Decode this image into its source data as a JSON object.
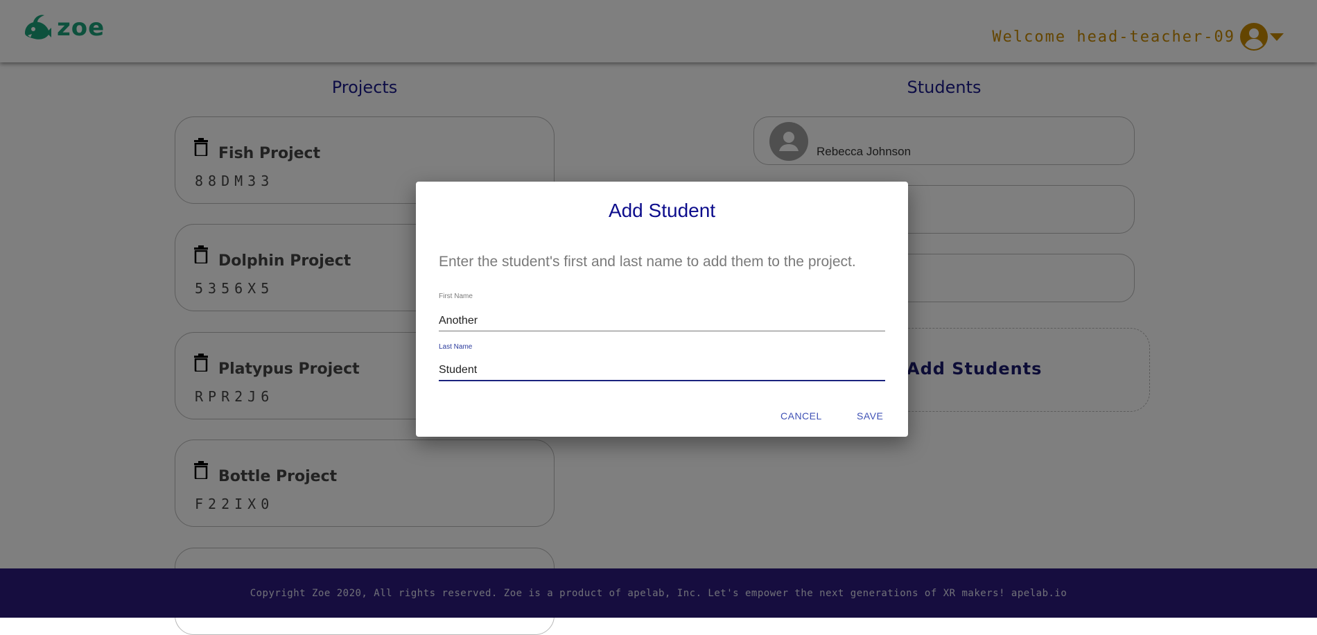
{
  "header": {
    "logo_text": "zoe",
    "welcome_text": "Welcome head-teacher-09"
  },
  "projects": {
    "title": "Projects",
    "items": [
      {
        "name": "Fish Project",
        "code": "88DM33"
      },
      {
        "name": "Dolphin Project",
        "code": "5356X5"
      },
      {
        "name": "Platypus Project",
        "code": "RPR2J6"
      },
      {
        "name": "Bottle Project",
        "code": "F22IX0"
      }
    ]
  },
  "students": {
    "title": "Students",
    "items": [
      {
        "name": "Rebecca Johnson"
      }
    ],
    "add_label": "Add Students"
  },
  "footer": {
    "text": "Copyright Zoe 2020, All rights reserved. Zoe is a product of apelab, Inc. Let's empower the next generations of XR makers! apelab.io"
  },
  "dialog": {
    "title": "Add Student",
    "description": "Enter the student's first and last name to add them to the project.",
    "first_name_label": "First Name",
    "first_name_value": "Another",
    "last_name_label": "Last Name",
    "last_name_value": "Student",
    "cancel_label": "CANCEL",
    "save_label": "SAVE"
  },
  "colors": {
    "brand_green": "#1aa37a",
    "welcome_gold": "#c98a00",
    "title_navy": "#1a1a8c",
    "footer_purple": "#2d1a7e",
    "button_blue": "#3f51b5"
  }
}
